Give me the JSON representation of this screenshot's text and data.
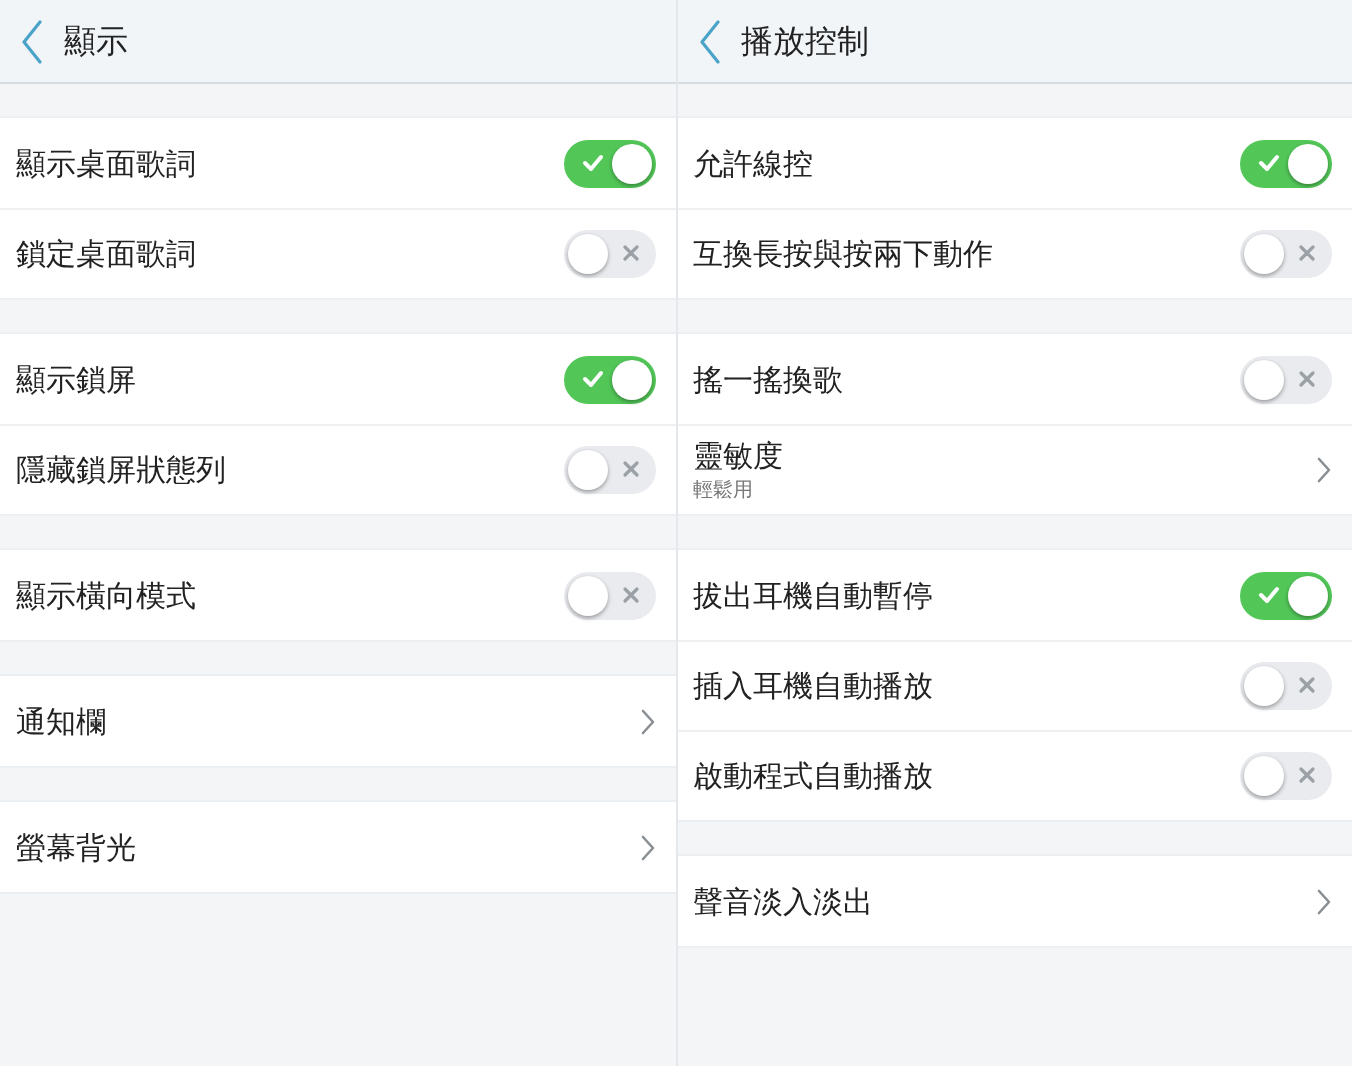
{
  "panels": [
    {
      "title": "顯示",
      "groups": [
        {
          "rows": [
            {
              "kind": "toggle",
              "label": "顯示桌面歌詞",
              "on": true
            },
            {
              "kind": "toggle",
              "label": "鎖定桌面歌詞",
              "on": false
            }
          ]
        },
        {
          "rows": [
            {
              "kind": "toggle",
              "label": "顯示鎖屏",
              "on": true
            },
            {
              "kind": "toggle",
              "label": "隱藏鎖屏狀態列",
              "on": false
            }
          ]
        },
        {
          "rows": [
            {
              "kind": "toggle",
              "label": "顯示橫向模式",
              "on": false
            }
          ]
        },
        {
          "rows": [
            {
              "kind": "nav",
              "label": "通知欄"
            }
          ]
        },
        {
          "rows": [
            {
              "kind": "nav",
              "label": "螢幕背光"
            }
          ]
        }
      ]
    },
    {
      "title": "播放控制",
      "groups": [
        {
          "rows": [
            {
              "kind": "toggle",
              "label": "允許線控",
              "on": true
            },
            {
              "kind": "toggle",
              "label": "互換長按與按兩下動作",
              "on": false
            }
          ]
        },
        {
          "rows": [
            {
              "kind": "toggle",
              "label": "搖一搖換歌",
              "on": false
            },
            {
              "kind": "nav",
              "label": "靈敏度",
              "subtitle": "輕鬆用"
            }
          ]
        },
        {
          "rows": [
            {
              "kind": "toggle",
              "label": "拔出耳機自動暫停",
              "on": true
            },
            {
              "kind": "toggle",
              "label": "插入耳機自動播放",
              "on": false
            },
            {
              "kind": "toggle",
              "label": "啟動程式自動播放",
              "on": false
            }
          ]
        },
        {
          "rows": [
            {
              "kind": "nav",
              "label": "聲音淡入淡出"
            }
          ]
        }
      ]
    }
  ]
}
